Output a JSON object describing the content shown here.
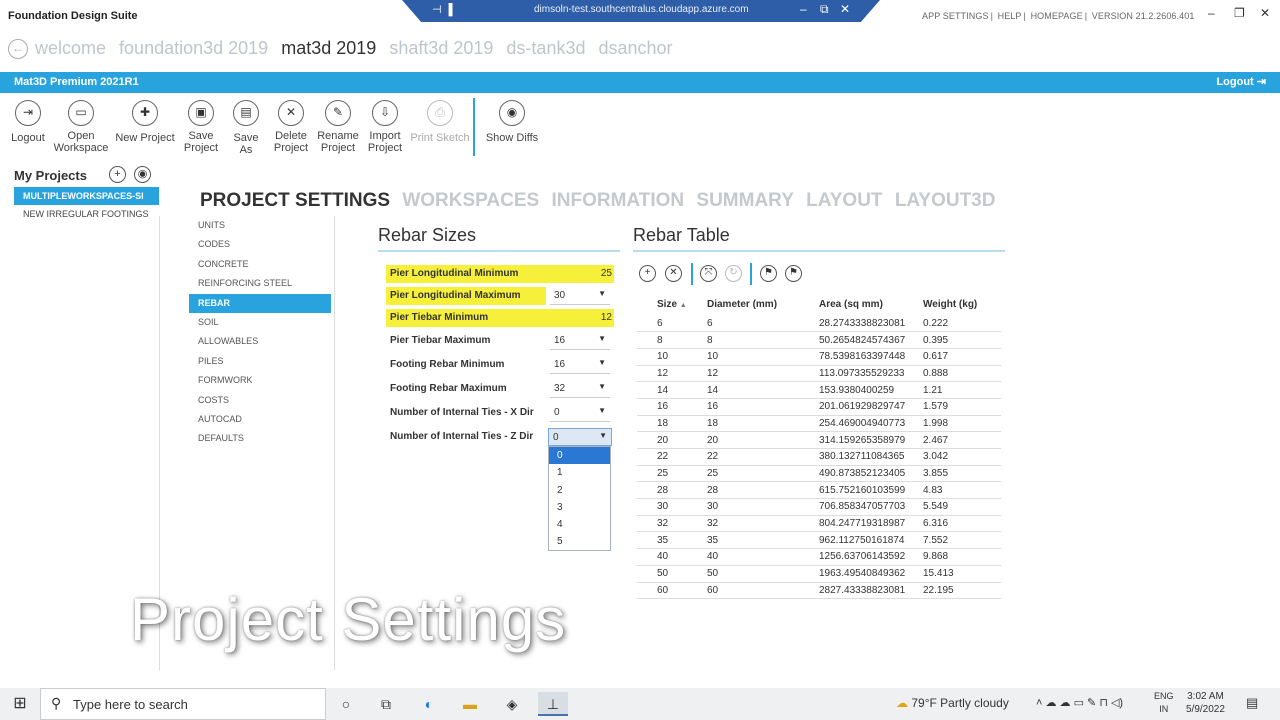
{
  "window": {
    "app_title": "Foundation Design Suite",
    "remote_host": "dimsoln-test.southcentralus.cloudapp.azure.com",
    "top_links": [
      "APP SETTINGS",
      "HELP",
      "HOMEPAGE",
      "VERSION 21.2.2606.401"
    ]
  },
  "app_tabs": [
    "welcome",
    "foundation3d 2019",
    "mat3d 2019",
    "shaft3d 2019",
    "ds-tank3d",
    "dsanchor"
  ],
  "app_tabs_active": "mat3d 2019",
  "bluebar": {
    "product": "Mat3D Premium 2021R1",
    "logout": "Logout"
  },
  "toolbar": [
    {
      "name": "logout",
      "label": "Logout",
      "icon": "exit-icon"
    },
    {
      "name": "open-workspace",
      "label": "Open Workspace",
      "icon": "folder-icon"
    },
    {
      "name": "new-project",
      "label": "New Project",
      "icon": "new-file-icon"
    },
    {
      "name": "save-project",
      "label": "Save Project",
      "icon": "save-icon"
    },
    {
      "name": "save-as",
      "label": "Save As",
      "icon": "save-as-icon"
    },
    {
      "name": "delete-project",
      "label": "Delete Project",
      "icon": "delete-icon"
    },
    {
      "name": "rename-project",
      "label": "Rename Project",
      "icon": "rename-icon"
    },
    {
      "name": "import-project",
      "label": "Import Project",
      "icon": "import-icon"
    },
    {
      "name": "print-sketch",
      "label": "Print Sketch",
      "icon": "print-icon",
      "disabled": true
    },
    {
      "name": "show-diffs",
      "label": "Show Diffs",
      "icon": "eye-icon"
    }
  ],
  "my_projects": {
    "title": "My Projects",
    "items": [
      "MULTIPLEWORKSPACES-SI",
      "NEW IRREGULAR FOOTINGS"
    ],
    "selected": "MULTIPLEWORKSPACES-SI"
  },
  "section_tabs": [
    "PROJECT SETTINGS",
    "WORKSPACES",
    "INFORMATION",
    "SUMMARY",
    "LAYOUT",
    "LAYOUT3D"
  ],
  "section_active": "PROJECT SETTINGS",
  "settings_menu": [
    "UNITS",
    "CODES",
    "CONCRETE",
    "REINFORCING STEEL",
    "REBAR",
    "SOIL",
    "ALLOWABLES",
    "PILES",
    "FORMWORK",
    "COSTS",
    "AUTOCAD",
    "DEFAULTS"
  ],
  "settings_selected": "REBAR",
  "rebar_sizes": {
    "title": "Rebar Sizes",
    "rows": [
      {
        "label": "Pier Longitudinal Minimum",
        "value": "25",
        "highlight": true,
        "control": "text"
      },
      {
        "label": "Pier Longitudinal Maximum",
        "value": "30",
        "highlight": true,
        "control": "dropdown"
      },
      {
        "label": "Pier Tiebar Minimum",
        "value": "12",
        "highlight": true,
        "control": "text"
      },
      {
        "label": "Pier Tiebar Maximum",
        "value": "16",
        "highlight": false,
        "control": "dropdown"
      },
      {
        "label": "Footing Rebar Minimum",
        "value": "16",
        "highlight": false,
        "control": "dropdown"
      },
      {
        "label": "Footing Rebar Maximum",
        "value": "32",
        "highlight": false,
        "control": "dropdown"
      },
      {
        "label": "Number of Internal Ties - X Dir",
        "value": "0",
        "highlight": false,
        "control": "dropdown"
      },
      {
        "label": "Number of Internal Ties - Z Dir",
        "value": "0",
        "highlight": false,
        "control": "dropdown-open"
      }
    ],
    "open_dropdown_options": [
      "0",
      "1",
      "2",
      "3",
      "4",
      "5"
    ],
    "open_dropdown_selected": "0"
  },
  "rebar_table": {
    "title": "Rebar Table",
    "tools": [
      "add-icon",
      "remove-icon",
      "expand-icon",
      "refresh-icon",
      "bookmark-left-icon",
      "bookmark-right-icon"
    ],
    "columns": [
      "Size",
      "Diameter (mm)",
      "Area (sq mm)",
      "Weight (kg)"
    ],
    "rows": [
      [
        "6",
        "6",
        "28.2743338823081",
        "0.222"
      ],
      [
        "8",
        "8",
        "50.2654824574367",
        "0.395"
      ],
      [
        "10",
        "10",
        "78.5398163397448",
        "0.617"
      ],
      [
        "12",
        "12",
        "113.097335529233",
        "0.888"
      ],
      [
        "14",
        "14",
        "153.9380400259",
        "1.21"
      ],
      [
        "16",
        "16",
        "201.061929829747",
        "1.579"
      ],
      [
        "18",
        "18",
        "254.469004940773",
        "1.998"
      ],
      [
        "20",
        "20",
        "314.159265358979",
        "2.467"
      ],
      [
        "22",
        "22",
        "380.132711084365",
        "3.042"
      ],
      [
        "25",
        "25",
        "490.873852123405",
        "3.855"
      ],
      [
        "28",
        "28",
        "615.752160103599",
        "4.83"
      ],
      [
        "30",
        "30",
        "706.858347057703",
        "5.549"
      ],
      [
        "32",
        "32",
        "804.247719318987",
        "6.316"
      ],
      [
        "35",
        "35",
        "962.112750161874",
        "7.552"
      ],
      [
        "40",
        "40",
        "1256.63706143592",
        "9.868"
      ],
      [
        "50",
        "50",
        "1963.49540849362",
        "15.413"
      ],
      [
        "60",
        "60",
        "2827.43338823081",
        "22.195"
      ]
    ]
  },
  "caption": "Project Settings",
  "taskbar": {
    "search_placeholder": "Type here to search",
    "weather": "79°F  Partly cloudy",
    "lang_top": "ENG",
    "lang_bottom": "IN",
    "time": "3:02 AM",
    "date": "5/9/2022"
  }
}
